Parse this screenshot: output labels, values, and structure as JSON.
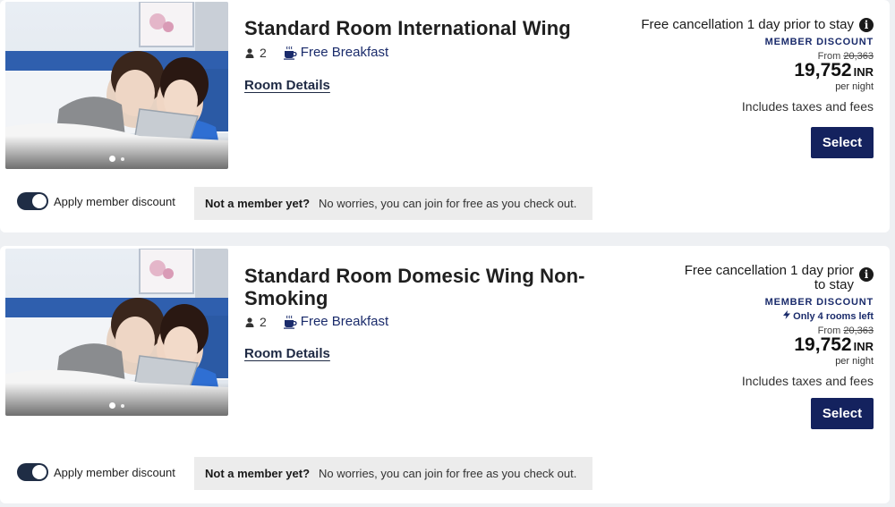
{
  "rooms": [
    {
      "title": "Standard Room International Wing",
      "guests": "2",
      "breakfast": "Free Breakfast",
      "details_link": "Room Details",
      "cancellation": "Free cancellation 1 day prior to stay",
      "member_badge": "MEMBER DISCOUNT",
      "rooms_left": "",
      "from_label": "From",
      "old_price": "20,363",
      "price": "19,752",
      "currency": "INR",
      "per_night": "per night",
      "taxes": "Includes taxes and fees",
      "select_label": "Select",
      "toggle_label": "Apply member discount",
      "promo_bold": "Not a member yet?",
      "promo_text": "No worries, you can join for free as you check out."
    },
    {
      "title": "Standard Room Domesic Wing Non-Smoking",
      "guests": "2",
      "breakfast": "Free Breakfast",
      "details_link": "Room Details",
      "cancellation": "Free cancellation 1 day prior to stay",
      "member_badge": "MEMBER DISCOUNT",
      "rooms_left": "Only 4 rooms left",
      "from_label": "From",
      "old_price": "20,363",
      "price": "19,752",
      "currency": "INR",
      "per_night": "per night",
      "taxes": "Includes taxes and fees",
      "select_label": "Select",
      "toggle_label": "Apply member discount",
      "promo_bold": "Not a member yet?",
      "promo_text": "No worries, you can join for free as you check out."
    }
  ],
  "icons": {
    "guest": "person-icon",
    "breakfast": "coffee-cup-icon",
    "info": "info-icon",
    "rooms_left": "lightning-icon"
  },
  "colors": {
    "brand_navy": "#14225e",
    "link_navy": "#1a2b6b",
    "promo_bg": "#ececec",
    "toggle_on": "#1f2d45"
  }
}
